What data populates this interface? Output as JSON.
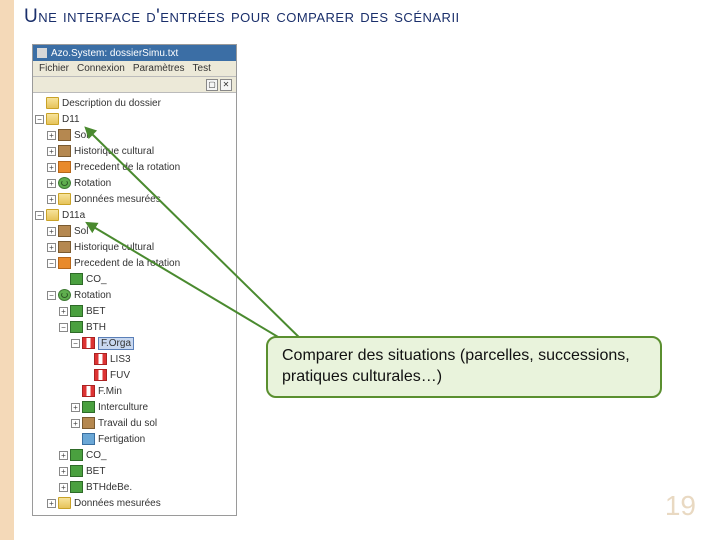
{
  "title": "Une interface d'entrées pour comparer des scénarii",
  "window": {
    "title": "Azo.System: dossierSimu.txt",
    "menu": [
      "Fichier",
      "Connexion",
      "Paramètres",
      "Test"
    ]
  },
  "tree": {
    "desc": "Description du dossier",
    "d11": "D11",
    "sol": "Sol",
    "hist": "Historique cultural",
    "prec": "Precedent de la rotation",
    "rot": "Rotation",
    "donnees": "Données mesurées",
    "d11a": "D11a",
    "sol2": "Sol",
    "hist2": "Historique cultural",
    "prec2": "Precedent de la rotation",
    "co_": "CO_",
    "rot2": "Rotation",
    "bet": "BET",
    "bth": "BTH",
    "forga": "F.Orga",
    "lis3": "LIS3",
    "fuv": "FUV",
    "fmin": "F.Min",
    "inter": "Interculture",
    "travail": "Travail du sol",
    "fertig": "Fertigation",
    "co_2": "CO_",
    "bet2": "BET",
    "bthdebe": "BTHdeBe.",
    "donnees2": "Données mesurées"
  },
  "callout": "Comparer des situations (parcelles, successions, pratiques culturales…)",
  "page": "19"
}
